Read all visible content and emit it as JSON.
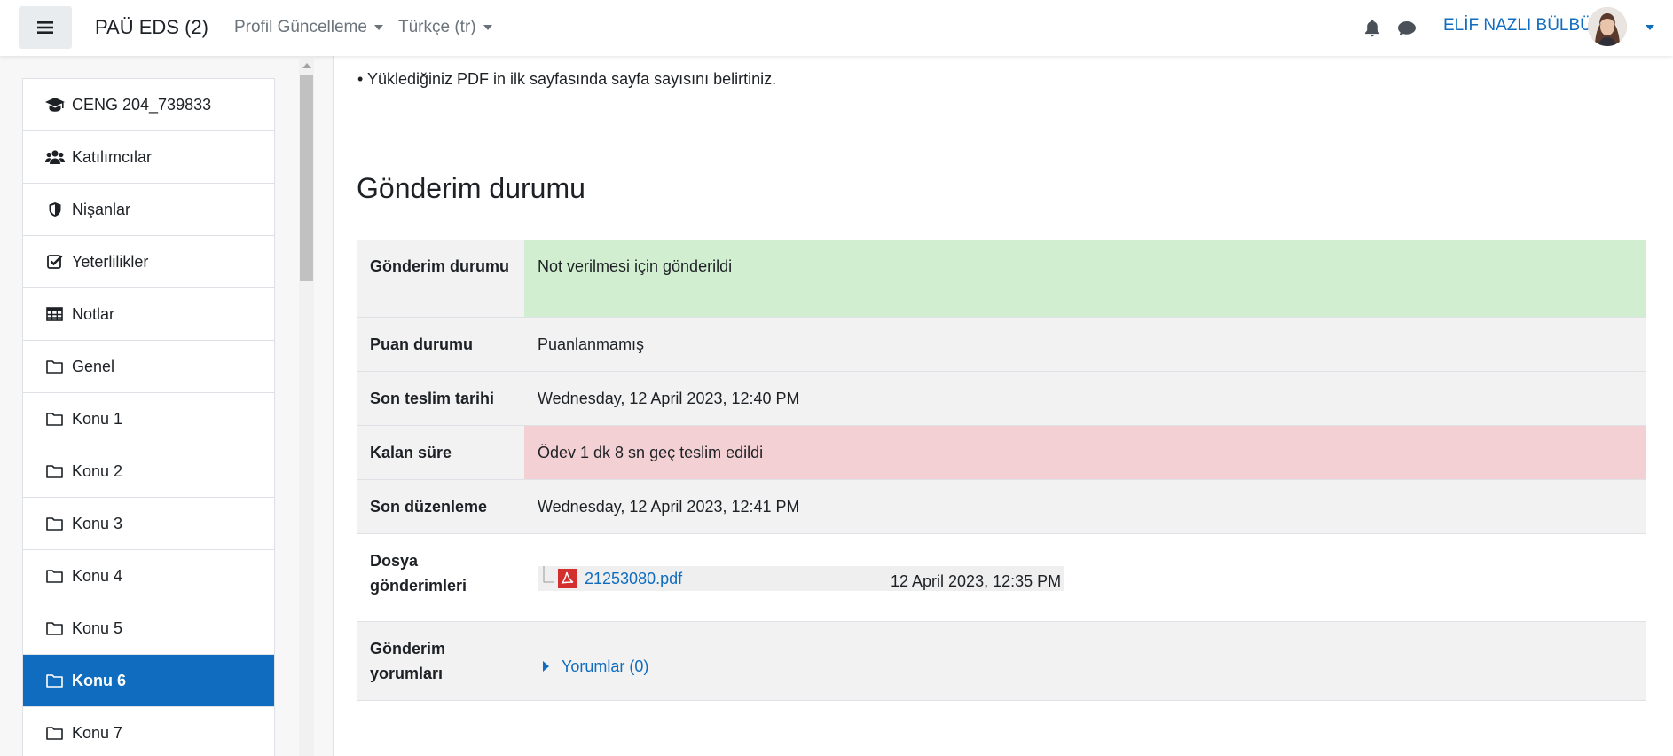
{
  "navbar": {
    "brand": "PAÜ EDS (2)",
    "menu_profile": "Profil Güncelleme",
    "menu_language": "Türkçe (tr)",
    "user_name": "ELİF NAZLI BÜLBÜL"
  },
  "sidebar": {
    "items": [
      {
        "label": "CENG 204_739833",
        "icon": "graduation-cap-icon"
      },
      {
        "label": "Katılımcılar",
        "icon": "users-icon"
      },
      {
        "label": "Nişanlar",
        "icon": "shield-icon"
      },
      {
        "label": "Yeterlilikler",
        "icon": "check-square-icon"
      },
      {
        "label": "Notlar",
        "icon": "table-icon"
      },
      {
        "label": "Genel",
        "icon": "folder-icon"
      },
      {
        "label": "Konu 1",
        "icon": "folder-icon"
      },
      {
        "label": "Konu 2",
        "icon": "folder-icon"
      },
      {
        "label": "Konu 3",
        "icon": "folder-icon"
      },
      {
        "label": "Konu 4",
        "icon": "folder-icon"
      },
      {
        "label": "Konu 5",
        "icon": "folder-icon"
      },
      {
        "label": "Konu 6",
        "icon": "folder-icon",
        "active": true
      },
      {
        "label": "Konu 7",
        "icon": "folder-icon"
      }
    ]
  },
  "main": {
    "note": "• Yüklediğiniz PDF in ilk sayfasında sayfa sayısını belirtiniz.",
    "section_title": "Gönderim durumu",
    "rows": {
      "submission_status": {
        "label": "Gönderim durumu",
        "value": "Not verilmesi için gönderildi"
      },
      "grading_status": {
        "label": "Puan durumu",
        "value": "Puanlanmamış"
      },
      "due_date": {
        "label": "Son teslim tarihi",
        "value": "Wednesday, 12 April 2023, 12:40 PM"
      },
      "time_remaining": {
        "label": "Kalan süre",
        "value": "Ödev 1 dk 8 sn geç teslim edildi"
      },
      "last_modified": {
        "label": "Son düzenleme",
        "value": "Wednesday, 12 April 2023, 12:41 PM"
      },
      "file_submissions": {
        "label": "Dosya gönderimleri",
        "file_name": "21253080.pdf",
        "file_date": "12 April 2023, 12:35 PM"
      },
      "submission_comments": {
        "label": "Gönderim yorumları",
        "link": "Yorumlar (0)"
      }
    }
  },
  "colors": {
    "accent": "#0f6cbf",
    "success_bg": "#d1efd0",
    "danger_bg": "#f2d0d3",
    "pdf_red": "#d32f2f"
  }
}
